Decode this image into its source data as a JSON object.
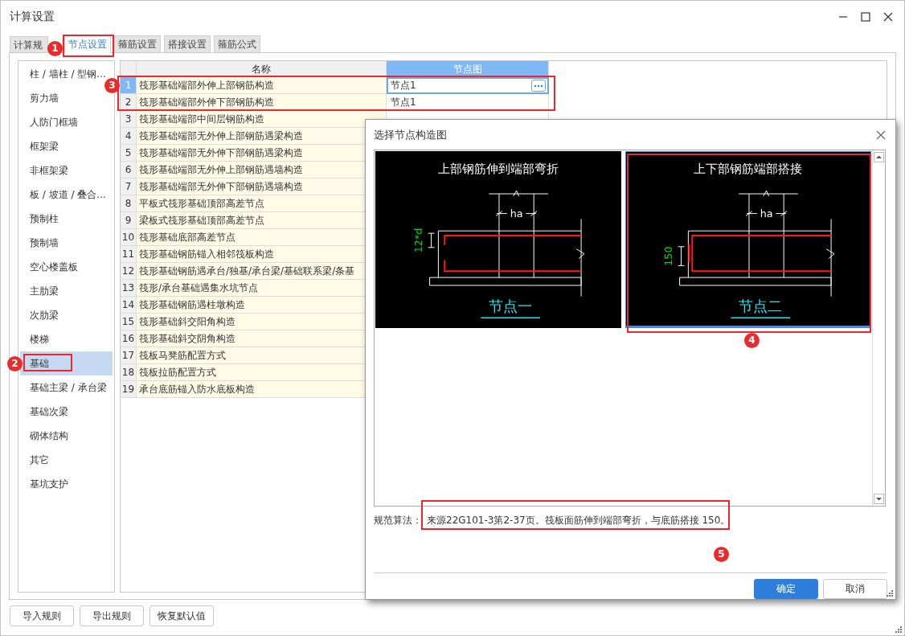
{
  "window": {
    "title": "计算设置"
  },
  "tabs": [
    {
      "label": "计算规",
      "selected": false
    },
    {
      "label": "节点设置",
      "selected": true
    },
    {
      "label": "箍筋设置",
      "selected": false
    },
    {
      "label": "搭接设置",
      "selected": false
    },
    {
      "label": "箍筋公式",
      "selected": false
    }
  ],
  "sidebar": {
    "items": [
      {
        "label": "柱 / 墙柱 / 型钢...",
        "selected": false
      },
      {
        "label": "剪力墙",
        "selected": false
      },
      {
        "label": "人防门框墙",
        "selected": false
      },
      {
        "label": "框架梁",
        "selected": false
      },
      {
        "label": "非框架梁",
        "selected": false
      },
      {
        "label": "板 / 坡道 / 叠合...",
        "selected": false
      },
      {
        "label": "预制柱",
        "selected": false
      },
      {
        "label": "预制墙",
        "selected": false
      },
      {
        "label": "空心楼盖板",
        "selected": false
      },
      {
        "label": "主肋梁",
        "selected": false
      },
      {
        "label": "次肋梁",
        "selected": false
      },
      {
        "label": "楼梯",
        "selected": false
      },
      {
        "label": "基础",
        "selected": true
      },
      {
        "label": "基础主梁 / 承台梁",
        "selected": false
      },
      {
        "label": "基础次梁",
        "selected": false
      },
      {
        "label": "砌体结构",
        "selected": false
      },
      {
        "label": "其它",
        "selected": false
      },
      {
        "label": "基坑支护",
        "selected": false
      }
    ]
  },
  "table": {
    "columns": [
      "名称",
      "节点图"
    ],
    "rows": [
      {
        "index": "1",
        "name": "筏形基础端部外伸上部钢筋构造",
        "value": "节点1",
        "selected": true
      },
      {
        "index": "2",
        "name": "筏形基础端部外伸下部钢筋构造",
        "value": "节点1",
        "selected": false
      },
      {
        "index": "3",
        "name": "筏形基础端部中间层钢筋构造",
        "selected": false
      },
      {
        "index": "4",
        "name": "筏形基础端部无外伸上部钢筋遇梁构造",
        "selected": false
      },
      {
        "index": "5",
        "name": "筏形基础端部无外伸下部钢筋遇梁构造",
        "selected": false
      },
      {
        "index": "6",
        "name": "筏形基础端部无外伸上部钢筋遇墙构造",
        "selected": false
      },
      {
        "index": "7",
        "name": "筏形基础端部无外伸下部钢筋遇墙构造",
        "selected": false
      },
      {
        "index": "8",
        "name": "平板式筏形基础顶部高差节点",
        "selected": false
      },
      {
        "index": "9",
        "name": "梁板式筏形基础顶部高差节点",
        "selected": false
      },
      {
        "index": "10",
        "name": "筏形基础底部高差节点",
        "selected": false
      },
      {
        "index": "11",
        "name": "筏形基础钢筋锚入相邻筏板构造",
        "selected": false
      },
      {
        "index": "12",
        "name": "筏形基础钢筋遇承台/独基/承台梁/基础联系梁/条基",
        "selected": false
      },
      {
        "index": "13",
        "name": "筏形/承台基础遇集水坑节点",
        "selected": false
      },
      {
        "index": "14",
        "name": "筏形基础钢筋遇柱墩构造",
        "selected": false
      },
      {
        "index": "15",
        "name": "筏形基础斜交阳角构造",
        "selected": false
      },
      {
        "index": "16",
        "name": "筏形基础斜交阴角构造",
        "selected": false
      },
      {
        "index": "17",
        "name": "筏板马凳筋配置方式",
        "selected": false
      },
      {
        "index": "18",
        "name": "筏板拉筋配置方式",
        "selected": false
      },
      {
        "index": "19",
        "name": "承台底筋锚入防水底板构造",
        "selected": false
      }
    ]
  },
  "dialog": {
    "title": "选择节点构造图",
    "nodes": [
      {
        "kind": "bend",
        "title": "上部钢筋伸到端部弯折",
        "dimension": "ha",
        "side_dimension": "12*d",
        "caption": "节点一",
        "selected": false
      },
      {
        "kind": "lap",
        "title": "上下部钢筋端部搭接",
        "dimension": "ha",
        "side_dimension": "150",
        "caption": "节点二",
        "selected": true
      }
    ],
    "description_label": "规范算法：",
    "description": "来源22G101-3第2-37页。筏板面筋伸到端部弯折，与底筋搭接 150。",
    "buttons": [
      {
        "label": "确定",
        "kind": "primary"
      },
      {
        "label": "取消",
        "kind": "default"
      }
    ]
  },
  "buttons": [
    "导入规则",
    "导出规则",
    "恢复默认值"
  ],
  "callouts": [
    "1",
    "2",
    "3",
    "4",
    "5"
  ]
}
